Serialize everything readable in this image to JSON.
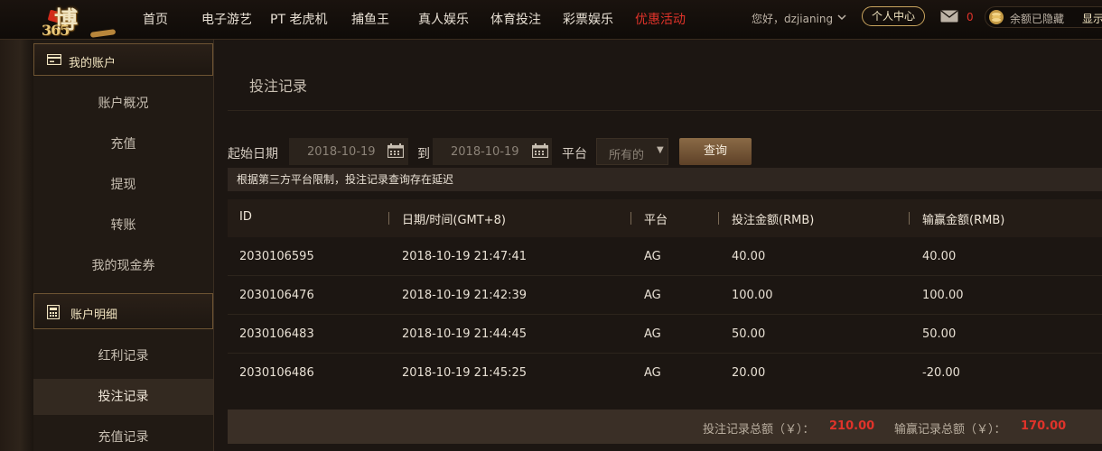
{
  "logo": {
    "brand_char": "博",
    "brand_num": "365"
  },
  "nav": {
    "items": [
      {
        "label": "首页",
        "active": false
      },
      {
        "label": "电子游艺",
        "active": false
      },
      {
        "label": "PT 老虎机",
        "active": false
      },
      {
        "label": "捕鱼王",
        "active": false
      },
      {
        "label": "真人娱乐",
        "active": false
      },
      {
        "label": "体育投注",
        "active": false
      },
      {
        "label": "彩票娱乐",
        "active": false
      },
      {
        "label": "优惠活动",
        "active": true
      }
    ],
    "greeting": "您好，dzjianing",
    "member_center": "个人中心",
    "mail_count": "0",
    "balance_text": "余额已隐藏",
    "show_label": "显示"
  },
  "sidebar": {
    "account_header": "我的账户",
    "account_items": [
      "账户概况",
      "充值",
      "提现",
      "转账",
      "我的现金券"
    ],
    "detail_header": "账户明细",
    "detail_items": [
      "红利记录",
      "投注记录",
      "充值记录"
    ],
    "selected": "投注记录"
  },
  "main": {
    "page_title": "投注记录",
    "filter": {
      "start_label": "起始日期",
      "start_date": "2018-10-19",
      "to_label": "到",
      "end_date": "2018-10-19",
      "platform_label": "平台",
      "platform_value": "所有的",
      "query_button": "查询"
    },
    "notice": "根据第三方平台限制，投注记录查询存在延迟",
    "table": {
      "headers": [
        "ID",
        "日期/时间(GMT+8)",
        "平台",
        "投注金额(RMB)",
        "输赢金额(RMB)"
      ],
      "rows": [
        [
          "2030106595",
          "2018-10-19 21:47:41",
          "AG",
          "40.00",
          "40.00"
        ],
        [
          "2030106476",
          "2018-10-19 21:42:39",
          "AG",
          "100.00",
          "100.00"
        ],
        [
          "2030106483",
          "2018-10-19 21:44:45",
          "AG",
          "50.00",
          "50.00"
        ],
        [
          "2030106486",
          "2018-10-19 21:45:25",
          "AG",
          "20.00",
          "-20.00"
        ]
      ]
    },
    "summary": {
      "bet_label": "投注记录总额（￥）：",
      "bet_total": "210.00",
      "win_label": "输赢记录总额（￥）：",
      "win_total": "170.00"
    }
  },
  "colors": {
    "accent_red": "#e0332a",
    "gold": "#c9a45e",
    "button_brown": "#6e4f33"
  }
}
